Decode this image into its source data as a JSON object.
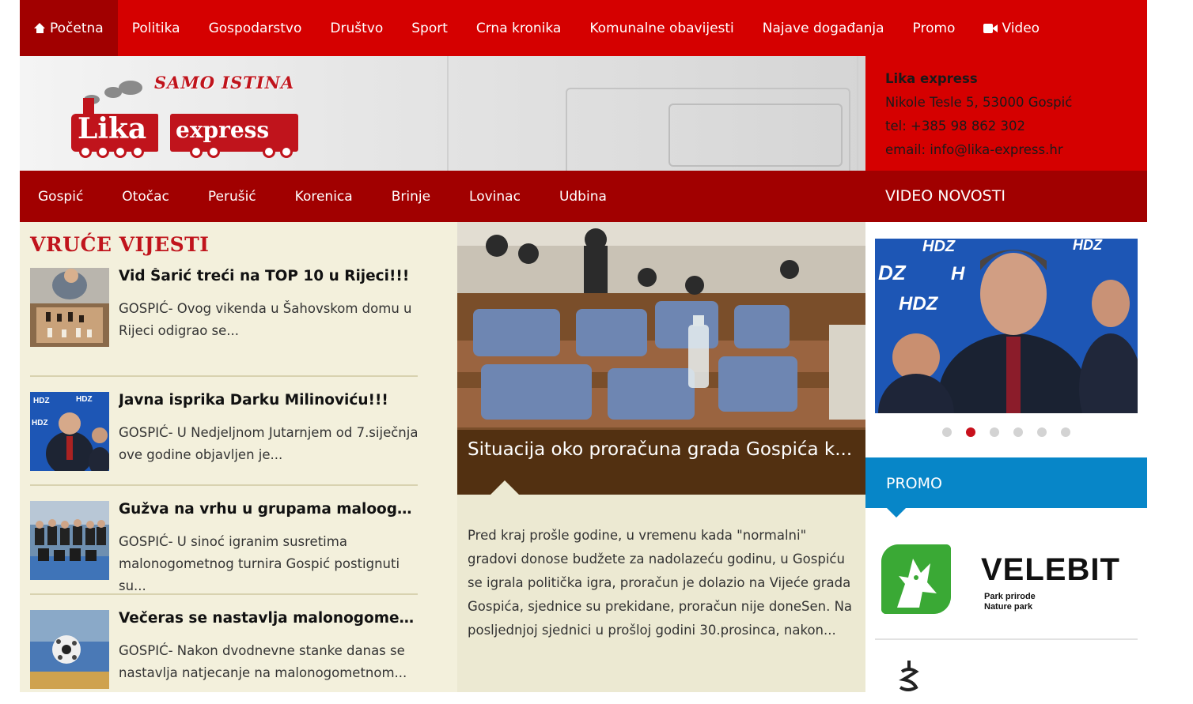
{
  "topnav": {
    "items": [
      {
        "label": "Početna",
        "icon": "home-icon"
      },
      {
        "label": "Politika"
      },
      {
        "label": "Gospodarstvo"
      },
      {
        "label": "Društvo"
      },
      {
        "label": "Sport"
      },
      {
        "label": "Crna kronika"
      },
      {
        "label": "Komunalne obavijesti"
      },
      {
        "label": "Najave događanja"
      },
      {
        "label": "Promo"
      },
      {
        "label": "Video",
        "icon": "video-camera-icon"
      }
    ]
  },
  "logo": {
    "tagline": "SAMO ISTINA",
    "word1": "Lika",
    "word2": "express"
  },
  "contact": {
    "name": "Lika express",
    "address": "Nikole Tesle 5, 53000 Gospić",
    "phone": "tel: +385 98 862 302",
    "email": "email: info@lika-express.hr"
  },
  "subnav": {
    "items": [
      "Gospić",
      "Otočac",
      "Perušić",
      "Korenica",
      "Brinje",
      "Lovinac",
      "Udbina"
    ]
  },
  "hot": {
    "title": "VRUĆE VIJESTI",
    "items": [
      {
        "headline": "Vid Šarić treći na TOP 10 u Rijeci!!!",
        "excerpt": "GOSPIĆ- Ovog vikenda u Šahovskom domu u Rijeci odigrao se..."
      },
      {
        "headline": "Javna isprika Darku Milinoviću!!!",
        "excerpt": "GOSPIĆ- U Nedjeljnom Jutarnjem od 7.siječnja ove godine objavljen je..."
      },
      {
        "headline": "Gužva na vrhu u grupama maloogome...",
        "excerpt": "GOSPIĆ- U sinoć igranim susretima malonogometnog turnira Gospić postignuti su..."
      },
      {
        "headline": "Večeras se nastavlja malonogometni t...",
        "excerpt": "GOSPIĆ- Nakon dvodnevne stanke danas se nastavlja natjecanje na malonogometnom..."
      }
    ]
  },
  "featured": {
    "caption": "Situacija oko proračuna grada Gospića k...",
    "body": "Pred kraj prošle godine, u vremenu kada \"normalni\" gradovi donose budžete za nadolazeću godinu, u Gospiću se igrala politička igra, proračun je dolazio na Vijeće grada Gospića, sjednice su prekidane, proračun nije doneSen. Na posljednjoj sjednici u prošloj godini 30.prosinca, nakon..."
  },
  "video": {
    "title": "VIDEO NOVOSTI",
    "slides": 6,
    "active_slide": 2,
    "banner_text": "HDZ"
  },
  "promo": {
    "title": "PROMO",
    "brand": "VELEBIT",
    "sub1": "Park prirode",
    "sub2": "Nature park"
  },
  "colors": {
    "red": "#d50000",
    "dark_red": "#a10000",
    "blue": "#0786c8",
    "cream": "#f3f0dc"
  }
}
